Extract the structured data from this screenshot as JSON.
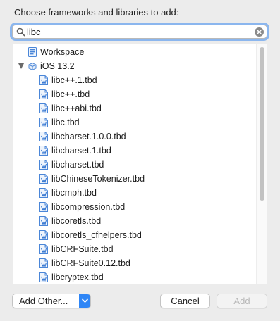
{
  "dialog": {
    "prompt": "Choose frameworks and libraries to add:"
  },
  "search": {
    "value": "libc",
    "icon": "magnifying-glass-icon",
    "clear_icon": "clear-circle-icon"
  },
  "tree": {
    "workspace_label": "Workspace",
    "sdk_label": "iOS 13.2",
    "sdk_expanded": true,
    "items": [
      {
        "label": "libc++.1.tbd"
      },
      {
        "label": "libc++.tbd"
      },
      {
        "label": "libc++abi.tbd"
      },
      {
        "label": "libc.tbd"
      },
      {
        "label": "libcharset.1.0.0.tbd"
      },
      {
        "label": "libcharset.1.tbd"
      },
      {
        "label": "libcharset.tbd"
      },
      {
        "label": "libChineseTokenizer.tbd"
      },
      {
        "label": "libcmph.tbd"
      },
      {
        "label": "libcompression.tbd"
      },
      {
        "label": "libcoretls.tbd"
      },
      {
        "label": "libcoretls_cfhelpers.tbd"
      },
      {
        "label": "libCRFSuite.tbd"
      },
      {
        "label": "libCRFSuite0.12.tbd"
      },
      {
        "label": "libcryptex.tbd"
      }
    ]
  },
  "buttons": {
    "add_other": "Add Other...",
    "cancel": "Cancel",
    "add": "Add"
  },
  "colors": {
    "accent": "#2f86f6",
    "focus_ring": "#8bb6ee"
  }
}
